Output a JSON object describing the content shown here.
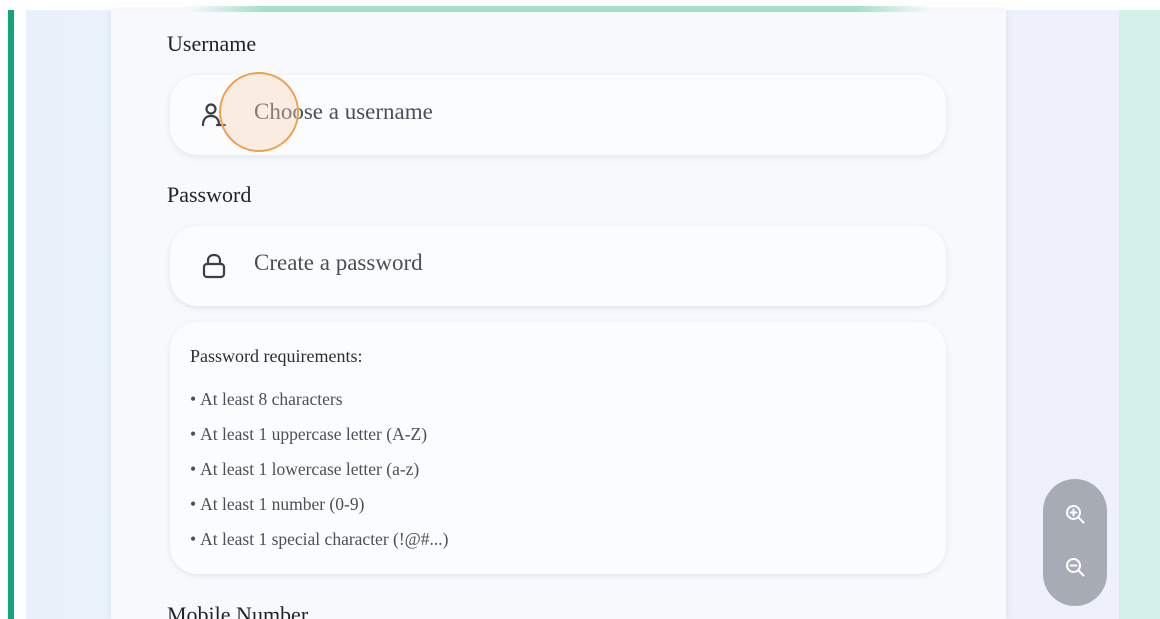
{
  "form": {
    "username": {
      "label": "Username",
      "placeholder": "Choose a username",
      "icon": "user-icon"
    },
    "password": {
      "label": "Password",
      "placeholder": "Create a password",
      "icon": "lock-icon"
    },
    "requirements": {
      "title": "Password requirements:",
      "items": [
        "At least 8 characters",
        "At least 1 uppercase letter (A-Z)",
        "At least 1 lowercase letter (a-z)",
        "At least 1 number (0-9)",
        "At least 1 special character (!@#...)"
      ]
    },
    "mobile": {
      "label": "Mobile Number"
    }
  },
  "zoom": {
    "in_icon": "zoom-in-icon",
    "out_icon": "zoom-out-icon"
  },
  "colors": {
    "accent": "#14a37f",
    "mint": "#d3f1e8",
    "click_indicator": "#f0a04b",
    "zoom_control": "#a7abb4"
  }
}
